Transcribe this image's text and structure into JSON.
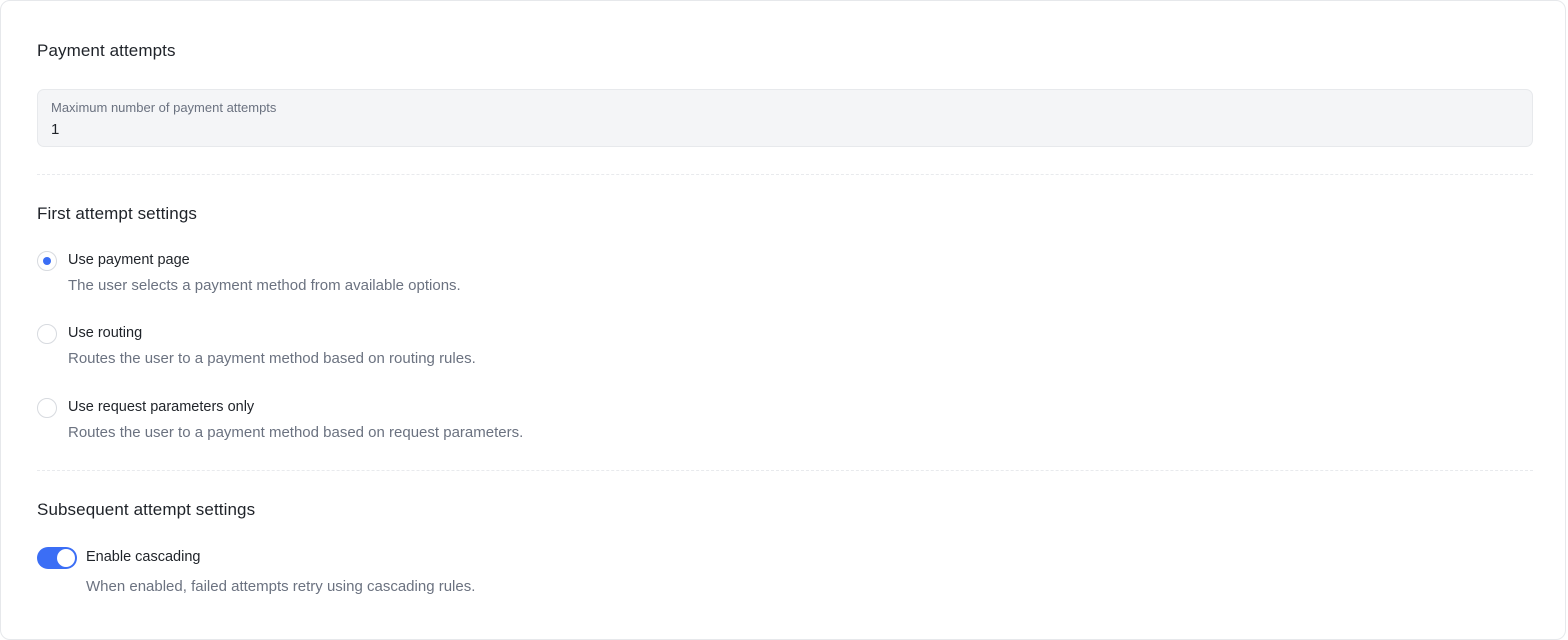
{
  "payment_attempts": {
    "title": "Payment attempts",
    "max_attempts_label": "Maximum number of payment attempts",
    "max_attempts_value": "1"
  },
  "first_attempt": {
    "title": "First attempt settings",
    "selected": "payment_page",
    "options": [
      {
        "id": "payment_page",
        "label": "Use payment page",
        "description": "The user selects a payment method from available options.",
        "checked": true
      },
      {
        "id": "routing",
        "label": "Use routing",
        "description": "Routes the user to a payment method based on routing rules.",
        "checked": false
      },
      {
        "id": "request_params",
        "label": "Use request parameters only",
        "description": "Routes the user to a payment method based on request parameters.",
        "checked": false
      }
    ]
  },
  "subsequent_attempt": {
    "title": "Subsequent attempt settings",
    "cascading": {
      "label": "Enable cascading",
      "description": "When enabled, failed attempts retry using cascading rules.",
      "enabled": true
    }
  },
  "colors": {
    "accent": "#3b6ef5",
    "field_bg": "#f4f5f7",
    "text_primary": "#1f2329",
    "text_secondary": "#6b7280"
  }
}
